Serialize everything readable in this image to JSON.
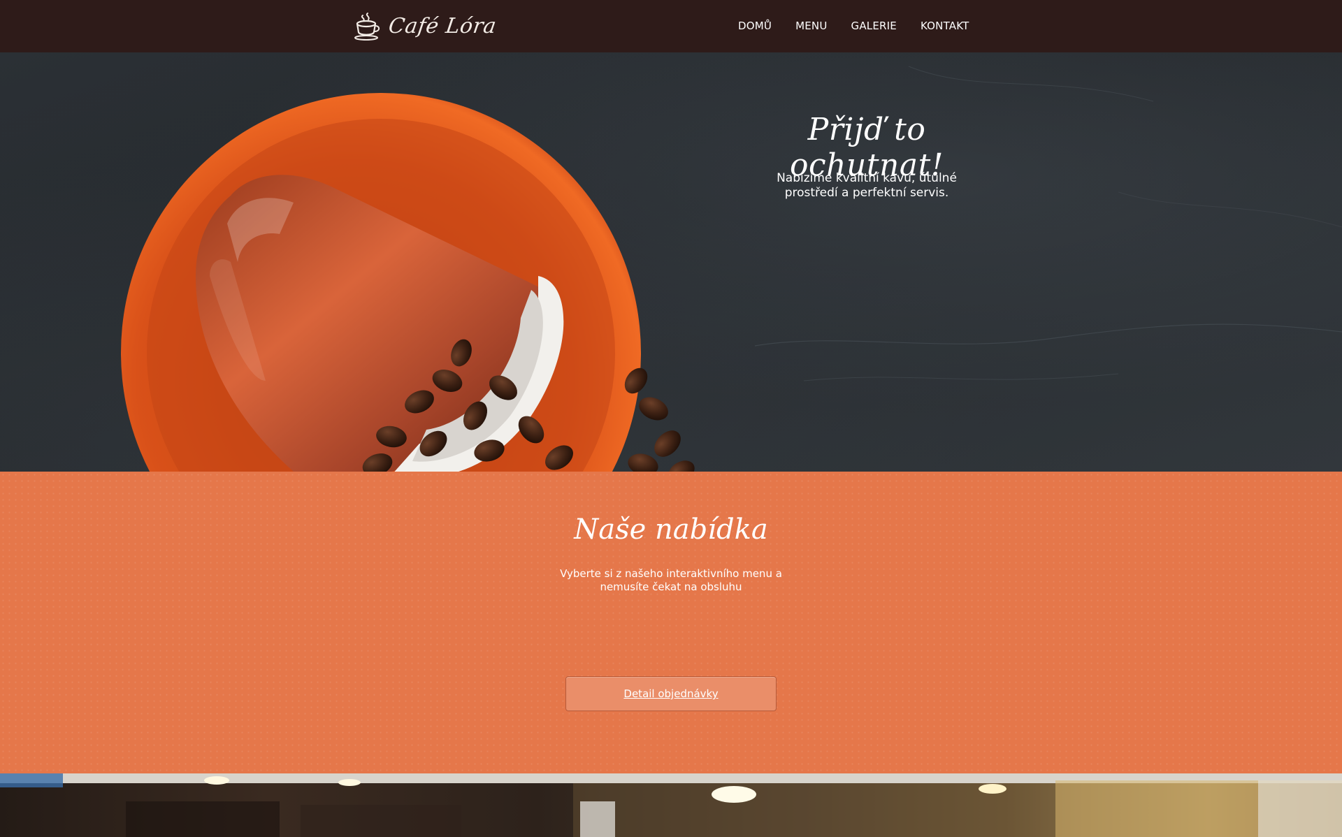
{
  "header": {
    "brand": "Café Lóra",
    "nav": [
      {
        "label": "DOMŮ"
      },
      {
        "label": "MENU"
      },
      {
        "label": "GALERIE"
      },
      {
        "label": "KONTAKT"
      }
    ]
  },
  "hero": {
    "title": "Přijď to ochutnat!",
    "subtitle": "Nabízíme kvalitní kávu, útulné prostředí a perfektní servis."
  },
  "offer": {
    "title": "Naše nabídka",
    "subtitle": "Vyberte si z našeho interaktivního menu a nemusíte čekat na obsluhu",
    "button_label": "Detail objednávky"
  },
  "colors": {
    "header_bg": "#2e1b19",
    "offer_bg": "#e5774a",
    "button_bg": "#ea8e69",
    "cup_orange": "#e0511c"
  }
}
